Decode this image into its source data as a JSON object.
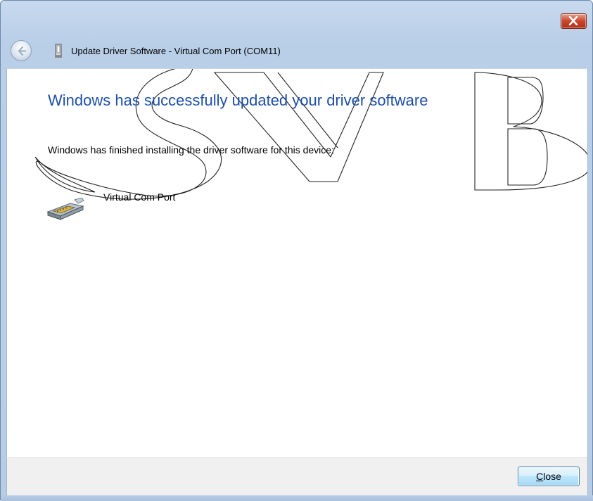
{
  "window": {
    "title": "Update Driver Software - Virtual Com Port (COM11)",
    "close_icon": "close-x-icon"
  },
  "header": {
    "back_icon": "back-arrow-icon",
    "device_icon": "usb-device-icon"
  },
  "main": {
    "heading": "Windows has successfully updated your driver software",
    "description": "Windows has finished installing the driver software for this device:",
    "device_name": "Virtual Com Port",
    "device_icon": "serial-port-icon",
    "watermark_text": "SVB"
  },
  "footer": {
    "close_label_underlined": "C",
    "close_label_rest": "lose"
  },
  "colors": {
    "heading": "#1e4fa8",
    "close_button": "#c9452c",
    "frame": "#b9cfe8"
  }
}
